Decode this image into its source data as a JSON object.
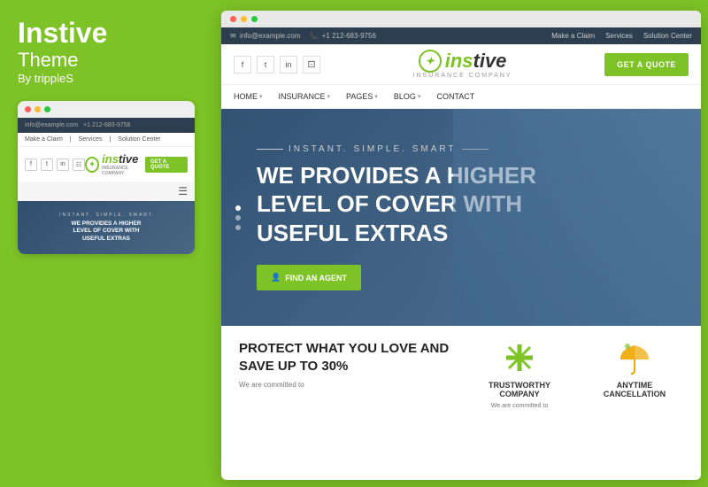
{
  "leftPanel": {
    "title": "Instive",
    "subtitle": "Theme",
    "by": "By trippleS"
  },
  "previewCard": {
    "email": "info@example.com",
    "phone": "+1 212-683-9756",
    "navItems": [
      "Make a Claim",
      "Services",
      "Solution Center"
    ],
    "logoText": "instive",
    "logoSub": "INSURANCE COMPANY",
    "getQuote": "GET A QUOTE",
    "heroTag": "INSTANT. SIMPLE. SMART",
    "heroTitle": "WE PROVIDES A HIGHER LEVEL OF COVER WITH USEFUL EXTRAS"
  },
  "browser": {
    "email": "info@example.com",
    "phone": "+1 212-683-9756",
    "navRight": [
      "Make a Claim",
      "Services",
      "Solution Center"
    ],
    "socialIcons": [
      "f",
      "t",
      "in",
      "cam"
    ],
    "logoText": "instive",
    "logoSub": "INSURANCE COMPANY",
    "getQuote": "GET A QUOTE",
    "nav": [
      {
        "label": "HOME",
        "arrow": true
      },
      {
        "label": "INSURANCE",
        "arrow": true
      },
      {
        "label": "PAGES",
        "arrow": true
      },
      {
        "label": "BLOG",
        "arrow": true
      },
      {
        "label": "CONTACT",
        "arrow": false
      }
    ],
    "heroTag": "INSTANT. SIMPLE. SMART",
    "heroTitle": "WE PROVIDES A HIGHER LEVEL OF COVER WITH USEFUL EXTRAS",
    "heroBtn": "FIND AN AGENT",
    "bottomLeft": {
      "title": "PROTECT WHAT YOU LOVE AND SAVE UP TO 30%",
      "text": "We are committed to"
    },
    "features": [
      {
        "icon": "cross",
        "title": "TRUSTWORTHY COMPANY",
        "text": "We are committed to"
      },
      {
        "icon": "umbrella",
        "title": "ANYTIME CANCELLATION",
        "text": ""
      }
    ]
  }
}
